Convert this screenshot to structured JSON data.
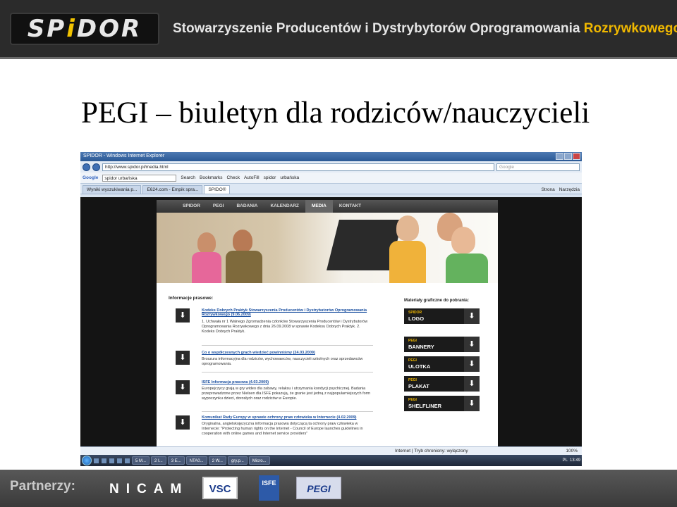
{
  "header": {
    "logo": "SPiDOR",
    "org_name": "Stowarzyszenie Producentów i Dystrybytorów Oprogramowania",
    "org_name_accent": "Rozrywkowego"
  },
  "slide_title": "PEGI – biuletyn dla rodziców/nauczycieli",
  "browser": {
    "window_title": "SPIDOR - Windows Internet Explorer",
    "address": "http://www.spidor.pl/media.html",
    "search_placeholder": "Google",
    "google_toolbar": {
      "brand": "Google",
      "query": "spidor urbańska",
      "items": [
        "Search",
        "Bookmarks",
        "Check",
        "AutoFill",
        "spidor",
        "urbańska"
      ]
    },
    "tabs": [
      "Wyniki wyszukiwania p...",
      "E624.com - Empik spra...",
      "SPIDO®"
    ],
    "tab_tools": [
      "Strona",
      "Narzędzia"
    ],
    "status_left": "",
    "status_mid": "Internet | Tryb chroniony: wyłączony",
    "zoom": "100%"
  },
  "site": {
    "nav": [
      "SPIDOR",
      "PEGI",
      "BADANIA",
      "KALENDARZ",
      "MEDIA",
      "KONTAKT"
    ],
    "active_nav": "MEDIA",
    "info_heading": "Informacje prasowe:",
    "news": [
      {
        "title": "Kodeks Dobrych Praktyk Stowarzyszenia Producentów i Dystrybutorów Oprogramowania Rozrywkowego",
        "date": "(9.06.2009)",
        "desc": "1. Uchwała nr 1 Walnego Zgromadzenia członków Stowarzyszenia Producentów i Dystrybutorów Oprogramowania Rozrywkowego z dnia 26.09.2008 w sprawie Kodeksu Dobrych Praktyk. 2. Kodeks Dobrych Praktyk."
      },
      {
        "title": "Co o współczesnych grach wiedzieć powinniśmy",
        "date": "(24.03.2009)",
        "desc": "Broszura informacyjna dla rodziców, wychowawców, nauczycieli szkolnych oraz sprzedawców oprogramowania."
      },
      {
        "title": "ISFE Informacja prasowa",
        "date": "(4.03.2009)",
        "desc": "Europejczycy grają w gry wideo dla zabawy, relaksu i utrzymania kondycji psychicznej. Badania przeprowadzone przez Nielsen dla ISFE pokazują, że granie jest jedną z najpopularniejszych form wypoczynku dzieci, dorosłych oraz rodziców w Europie."
      },
      {
        "title": "Komunikat Rady Europy w sprawie ochrony praw człowieka w Internecie",
        "date": "(4.02.2009)",
        "desc": "Oryginalna, angielskojęzyczna informacja prasowa dotyczącą ta ochrony praw człowieka w Internecie: \"Protecting human rights on the Internet - Council of Europe launches guidelines in cooperation with online games and Internet service providers\""
      }
    ],
    "materials_heading": "Materiały graficzne do pobrania:",
    "materials": [
      {
        "small": "SPIDOR",
        "big": "LOGO"
      },
      {
        "small": "PEGI",
        "big": "BANNERY"
      },
      {
        "small": "PEGI",
        "big": "ULOTKA"
      },
      {
        "small": "PEGI",
        "big": "PLAKAT"
      },
      {
        "small": "PEGI",
        "big": "SHELFLINER"
      }
    ]
  },
  "taskbar": {
    "items": [
      "5 M...",
      "2 I...",
      "3 E...",
      "NTA0...",
      "2 W...",
      "gry.p...",
      "Micro..."
    ],
    "lang": "PL",
    "clock": "13:49"
  },
  "footer": {
    "partners_label": "Partnerzy:",
    "logos": [
      "NICAM",
      "VSC",
      "ISFE",
      "PEGI"
    ]
  }
}
